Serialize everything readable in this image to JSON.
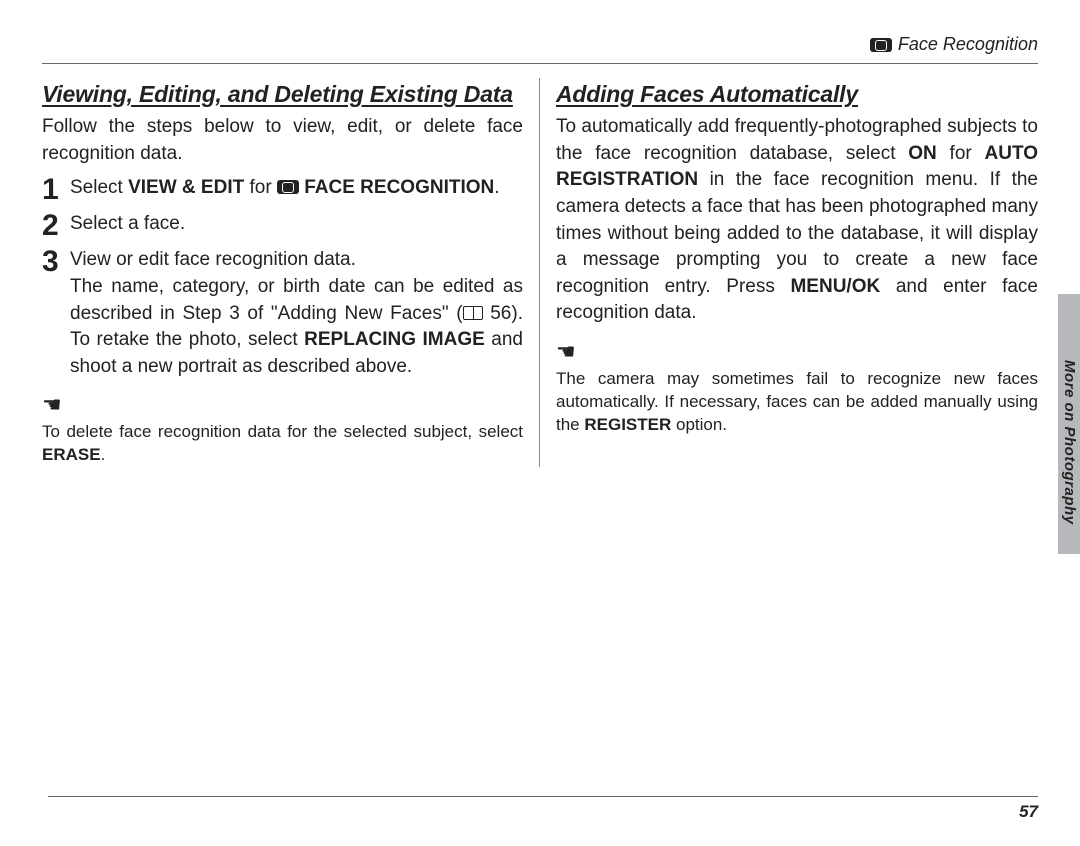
{
  "header": {
    "section": "Face Recognition"
  },
  "left": {
    "title": "Viewing, Editing, and Deleting Existing Data",
    "intro": "Follow the steps below to view, edit, or delete face recognition data.",
    "steps": {
      "s1_a": "Select ",
      "s1_b": "VIEW & EDIT",
      "s1_c": " for ",
      "s1_d": " FACE RECOGNITION",
      "s1_e": ".",
      "s2": "Select a face.",
      "s3_head": "View or edit face recognition data.",
      "s3_body_a": "The name, category, or birth date can be edited as described in Step 3 of \"Adding New Faces\" (",
      "s3_body_b": " 56). To retake the photo, select ",
      "s3_body_c": "REPLACING IMAGE",
      "s3_body_d": " and shoot a new portrait as described above."
    },
    "note_a": "To delete face recognition data for the selected subject, select ",
    "note_b": "ERASE",
    "note_c": "."
  },
  "right": {
    "title": "Adding Faces Automatically",
    "body_a": "To automatically add frequently-photographed subjects to the face recognition database, select ",
    "body_b": "ON",
    "body_c": " for ",
    "body_d": "AUTO REGISTRATION",
    "body_e": " in the face recognition menu.  If the camera detects a face that has been photographed many times without being added to the database, it will display a message prompting you to create a new face recognition entry.  Press ",
    "body_f": "MENU/OK",
    "body_g": " and enter face recognition data.",
    "note_a": "The camera may sometimes fail to recognize new faces automatically.  If necessary, faces can be added manually using the ",
    "note_b": "REGISTER",
    "note_c": " option."
  },
  "sidebar": {
    "label": "More on Photography"
  },
  "page_number": "57"
}
